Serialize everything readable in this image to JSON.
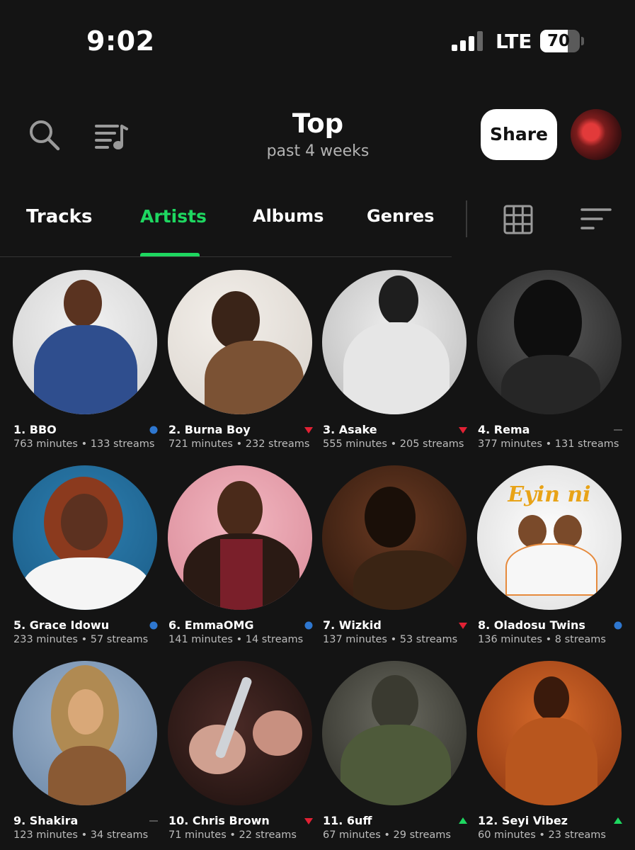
{
  "status_bar": {
    "time": "9:02",
    "network": "LTE",
    "battery": "70",
    "battery_level": 0.7
  },
  "header": {
    "title": "Top",
    "subtitle": "past 4 weeks",
    "share_label": "Share"
  },
  "tabs": [
    {
      "label": "Tracks",
      "active": false
    },
    {
      "label": "Artists",
      "active": true
    },
    {
      "label": "Albums",
      "active": false
    },
    {
      "label": "Genres",
      "active": false
    }
  ],
  "colors": {
    "accent": "#1ed760",
    "trend_up": "#1ed760",
    "trend_down": "#e22134",
    "trend_new": "#2e77d0",
    "trend_same": "#555555"
  },
  "artists": [
    {
      "name": "1. BBO",
      "stats": "763 minutes • 133 streams",
      "trend": "new"
    },
    {
      "name": "2. Burna Boy",
      "stats": "721 minutes • 232 streams",
      "trend": "down"
    },
    {
      "name": "3. Asake",
      "stats": "555 minutes • 205 streams",
      "trend": "down"
    },
    {
      "name": "4. Rema",
      "stats": "377 minutes • 131 streams",
      "trend": "same"
    },
    {
      "name": "5. Grace Idowu",
      "stats": "233 minutes • 57 streams",
      "trend": "new"
    },
    {
      "name": "6. EmmaOMG",
      "stats": "141 minutes • 14 streams",
      "trend": "new"
    },
    {
      "name": "7. Wizkid",
      "stats": "137 minutes • 53 streams",
      "trend": "down"
    },
    {
      "name": "8. Oladosu Twins",
      "stats": "136 minutes • 8 streams",
      "trend": "new",
      "artwork_text": "Eyin ni"
    },
    {
      "name": "9. Shakira",
      "stats": "123 minutes • 34 streams",
      "trend": "same"
    },
    {
      "name": "10. Chris Brown",
      "stats": "71 minutes • 22 streams",
      "trend": "down"
    },
    {
      "name": "11. 6uff",
      "stats": "67 minutes • 29 streams",
      "trend": "up"
    },
    {
      "name": "12. Seyi Vibez",
      "stats": "60 minutes • 23 streams",
      "trend": "up"
    }
  ]
}
